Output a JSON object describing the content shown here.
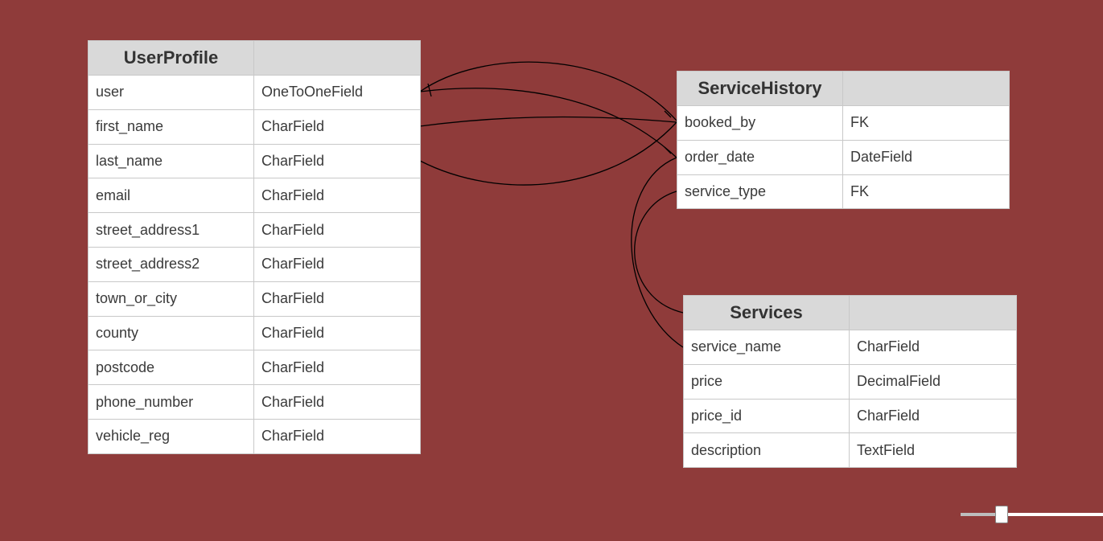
{
  "entities": {
    "user_profile": {
      "title": "UserProfile",
      "type_header": "",
      "fields": [
        {
          "name": "user",
          "type": "OneToOneField"
        },
        {
          "name": "first_name",
          "type": "CharField"
        },
        {
          "name": "last_name",
          "type": "CharField"
        },
        {
          "name": "email",
          "type": "CharField"
        },
        {
          "name": "street_address1",
          "type": "CharField"
        },
        {
          "name": "street_address2",
          "type": "CharField"
        },
        {
          "name": "town_or_city",
          "type": "CharField"
        },
        {
          "name": "county",
          "type": "CharField"
        },
        {
          "name": "postcode",
          "type": "CharField"
        },
        {
          "name": "phone_number",
          "type": "CharField"
        },
        {
          "name": "vehicle_reg",
          "type": "CharField"
        }
      ]
    },
    "service_history": {
      "title": "ServiceHistory",
      "type_header": "",
      "fields": [
        {
          "name": "booked_by",
          "type": "FK"
        },
        {
          "name": "order_date",
          "type": "DateField"
        },
        {
          "name": "service_type",
          "type": "FK"
        }
      ]
    },
    "services": {
      "title": "Services",
      "type_header": "",
      "fields": [
        {
          "name": "service_name",
          "type": "CharField"
        },
        {
          "name": "price",
          "type": "DecimalField"
        },
        {
          "name": "price_id",
          "type": "CharField"
        },
        {
          "name": "description",
          "type": "TextField"
        }
      ]
    }
  },
  "zoom_slider": {
    "level": 0.29
  },
  "colors": {
    "background": "#8f3b3a",
    "header": "#d9d9d9",
    "connector": "#000000"
  }
}
